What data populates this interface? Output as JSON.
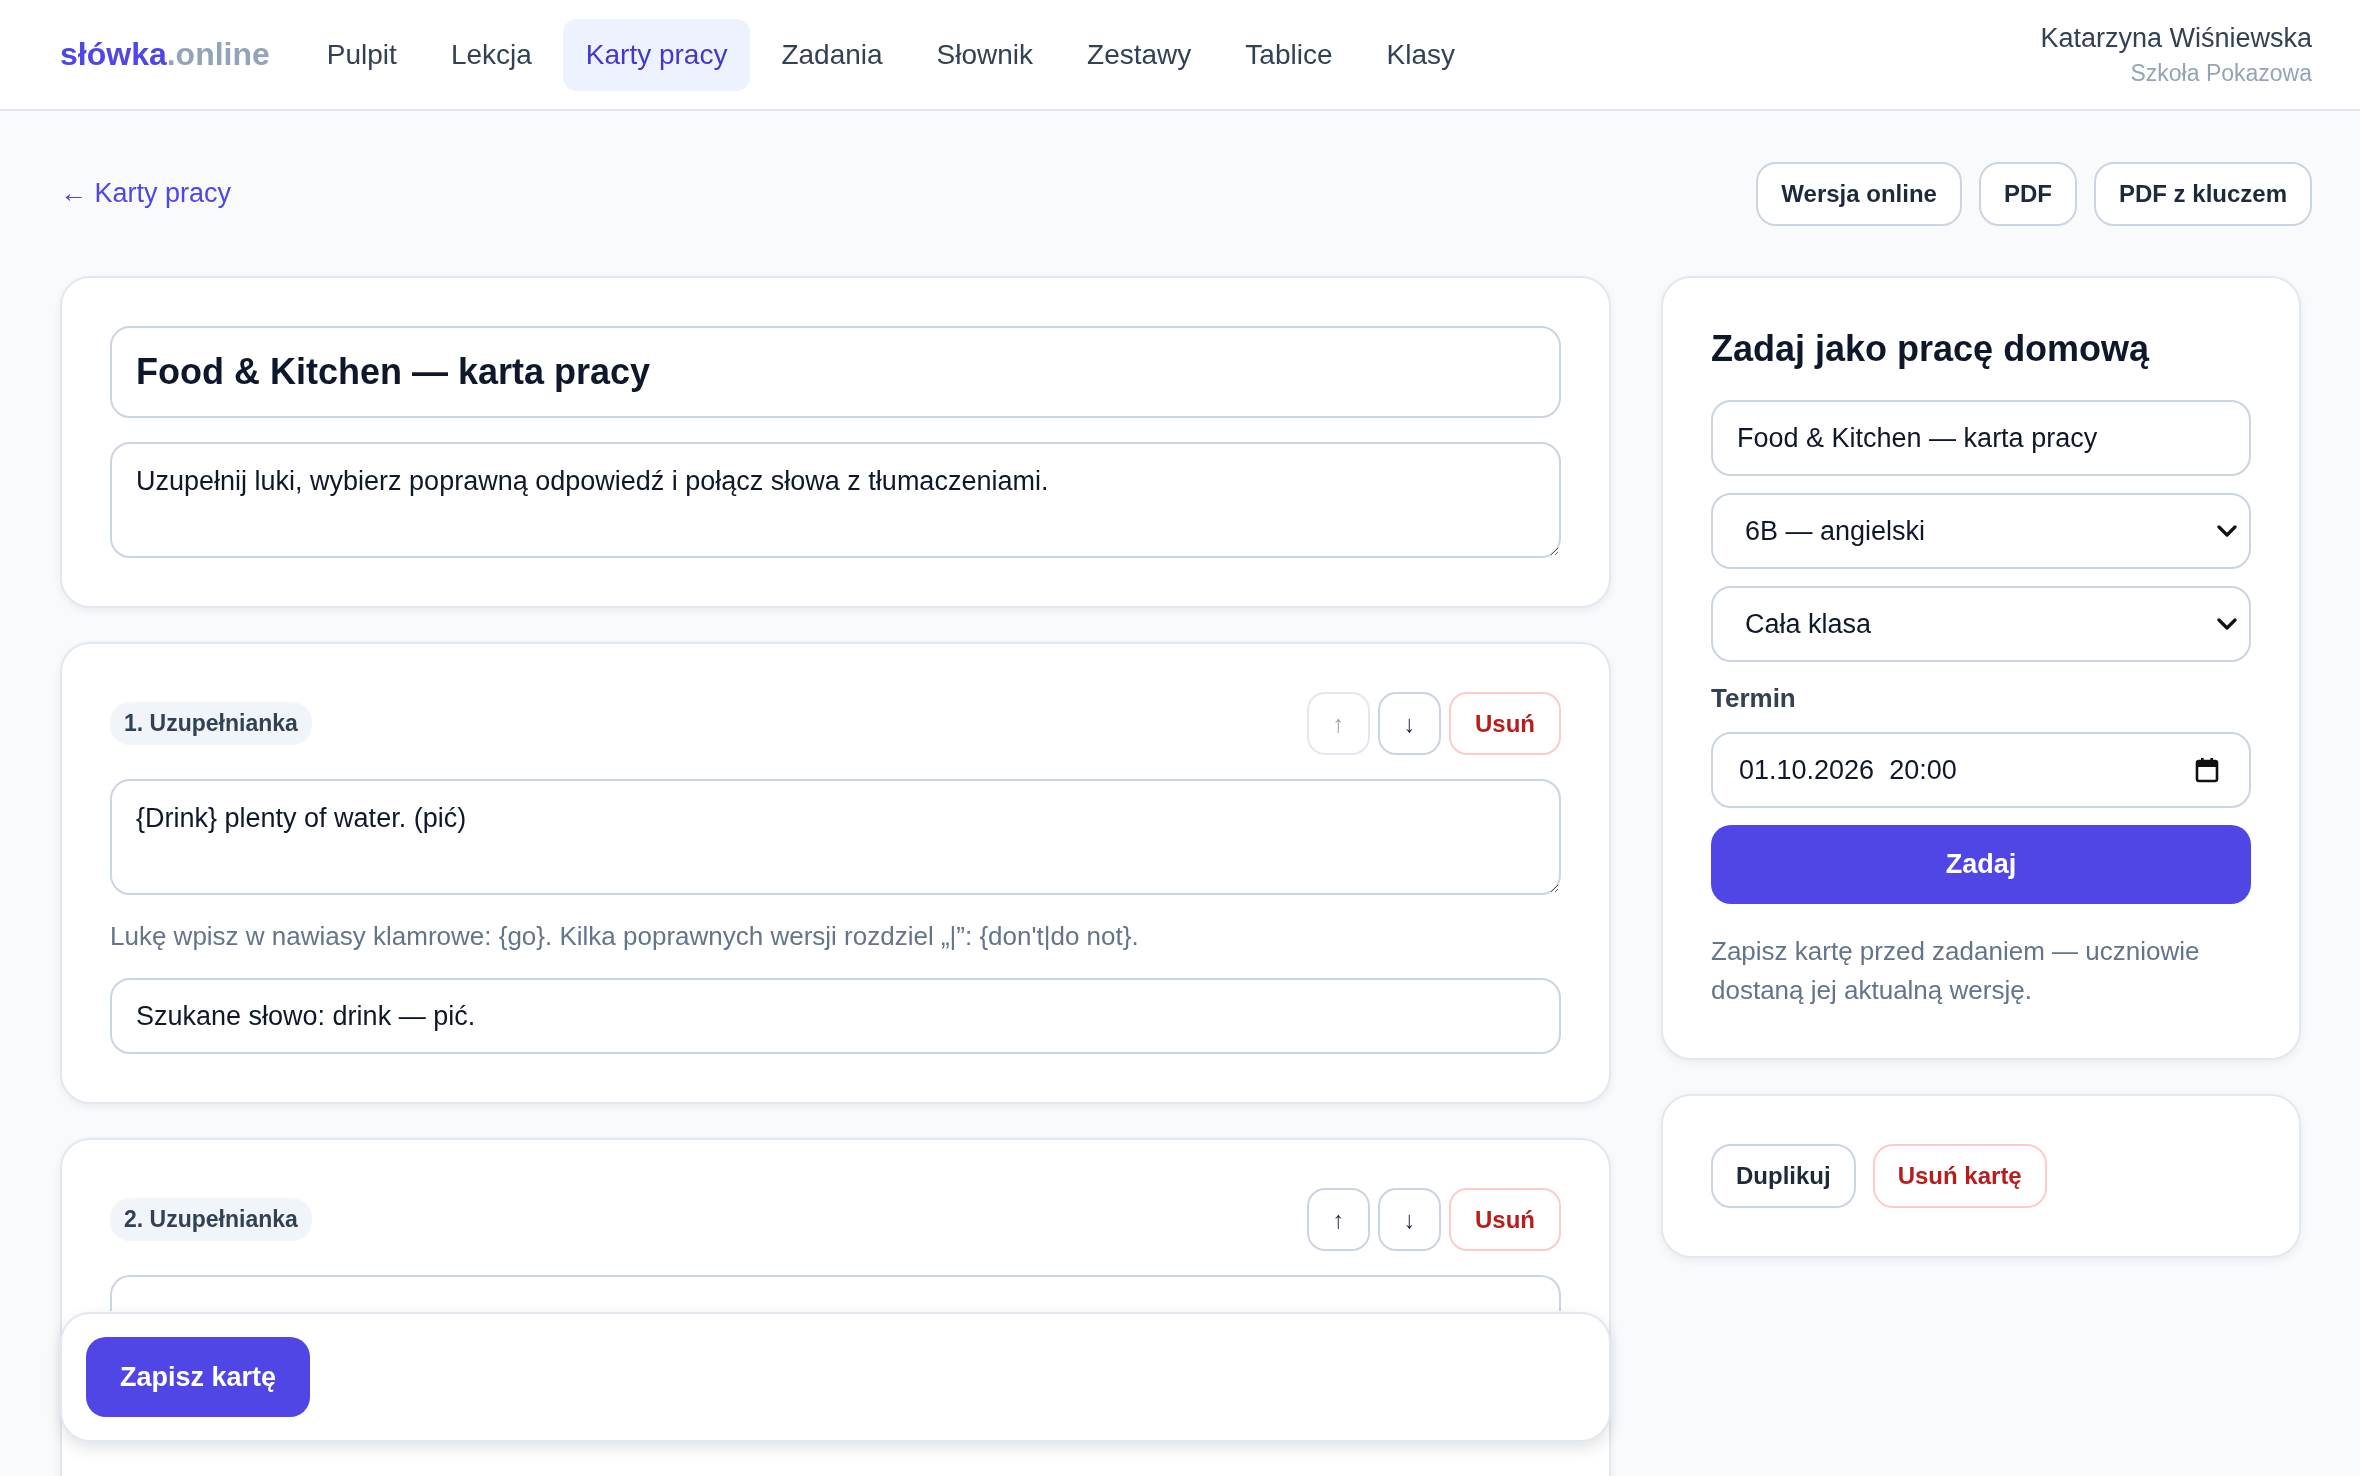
{
  "brand": {
    "name": "słówka",
    "suffix": ".online"
  },
  "nav": [
    {
      "label": "Pulpit",
      "selected": false
    },
    {
      "label": "Lekcja",
      "selected": false
    },
    {
      "label": "Karty pracy",
      "selected": true
    },
    {
      "label": "Zadania",
      "selected": false
    },
    {
      "label": "Słownik",
      "selected": false
    },
    {
      "label": "Zestawy",
      "selected": false
    },
    {
      "label": "Tablice",
      "selected": false
    },
    {
      "label": "Klasy",
      "selected": false
    }
  ],
  "user": {
    "name": "Katarzyna Wiśniewska",
    "school": "Szkoła Pokazowa"
  },
  "back_link": "← Karty pracy",
  "export_buttons": [
    "Wersja online",
    "PDF",
    "PDF z kluczem"
  ],
  "worksheet": {
    "title": "Food & Kitchen — karta pracy",
    "description": "Uzupełnij luki, wybierz poprawną odpowiedź i połącz słowa z tłumaczeniami."
  },
  "exercises": [
    {
      "label": "1. Uzupełnianka",
      "up": "↑",
      "up_disabled": true,
      "down": "↓",
      "down_disabled": false,
      "delete": "Usuń",
      "content": "{Drink} plenty of water. (pić)",
      "hint": "Lukę wpisz w nawiasy klamrowe: {go}. Kilka poprawnych wersji rozdziel „|”: {don't|do not}.",
      "answer": "Szukane słowo: drink — pić."
    },
    {
      "label": "2. Uzupełnianka",
      "up": "↑",
      "up_disabled": false,
      "down": "↓",
      "down_disabled": false,
      "delete": "Usuń"
    }
  ],
  "assign": {
    "title": "Zadaj jako pracę domową",
    "name": "Food & Kitchen — karta pracy",
    "class": "6B — angielski",
    "group": "Cała klasa",
    "deadline_label": "Termin",
    "deadline": "01.10.2026  20:00",
    "submit": "Zadaj",
    "note": "Zapisz kartę przed zadaniem — uczniowie dostaną jej aktualną wersję."
  },
  "card_actions": [
    {
      "label": "Duplikuj",
      "kind": "neutral"
    },
    {
      "label": "Usuń kartę",
      "kind": "danger"
    }
  ],
  "save_button": "Zapisz kartę"
}
